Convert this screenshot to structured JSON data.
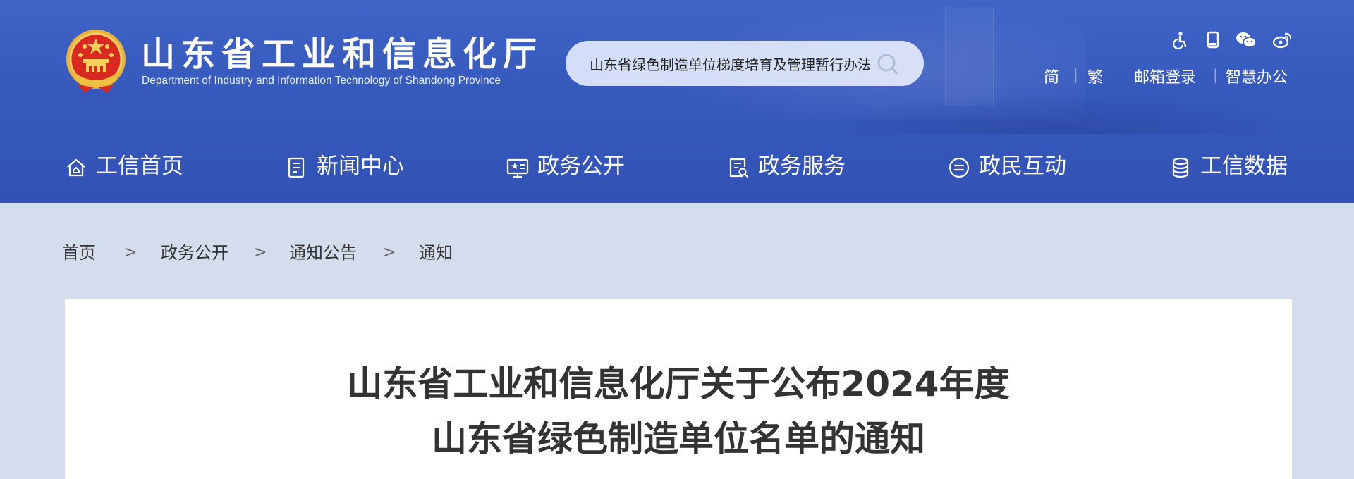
{
  "site": {
    "title": "山东省工业和信息化厅",
    "subtitle": "Department of Industry and Information Technology of Shandong Province"
  },
  "search": {
    "value": "山东省绿色制造单位梯度培育及管理暂行办法",
    "icon": "search-icon"
  },
  "utility": {
    "icons": [
      "accessibility-icon",
      "mobile-icon",
      "wechat-icon",
      "weibo-icon"
    ],
    "simplified": "简",
    "traditional": "繁",
    "separator": "|",
    "mail_login": "邮箱登录",
    "smart_office": "智慧办公"
  },
  "nav": {
    "items": [
      {
        "label": "工信首页",
        "icon": "home-icon"
      },
      {
        "label": "新闻中心",
        "icon": "news-icon"
      },
      {
        "label": "政务公开",
        "icon": "gov-open-icon"
      },
      {
        "label": "政务服务",
        "icon": "gov-service-icon"
      },
      {
        "label": "政民互动",
        "icon": "interaction-icon"
      },
      {
        "label": "工信数据",
        "icon": "database-icon"
      }
    ]
  },
  "breadcrumb": {
    "items": [
      "首页",
      "政务公开",
      "通知公告",
      "通知"
    ],
    "separator": ">"
  },
  "article": {
    "title_line1": "山东省工业和信息化厅关于公布2024年度",
    "title_line2": "山东省绿色制造单位名单的通知"
  },
  "colors": {
    "header_bg": "#3658bd",
    "page_bg": "#d3ddee",
    "title_text": "#333333"
  }
}
